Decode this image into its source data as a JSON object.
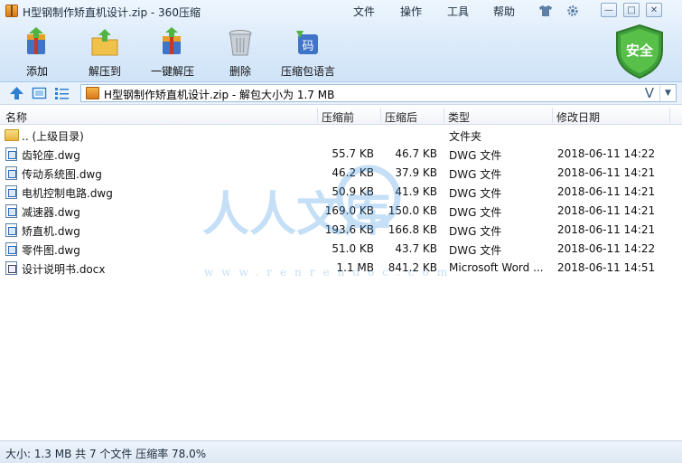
{
  "window": {
    "title": "H型钢制作矫直机设计.zip - 360压缩",
    "menu": [
      "文件",
      "操作",
      "工具",
      "帮助"
    ]
  },
  "toolbar": {
    "add": "添加",
    "extract_to": "解压到",
    "one_click_extract": "一键解压",
    "delete": "删除",
    "encoding": "压缩包语言",
    "encoding_icon_text": "码"
  },
  "security": {
    "label": "安全"
  },
  "address": {
    "path": "H型钢制作矫直机设计.zip - 解包大小为 1.7 MB",
    "v_glyph": "V"
  },
  "columns": {
    "name": "名称",
    "compressed_size": "压缩前",
    "packed_size": "压缩后",
    "type": "类型",
    "modified": "修改日期"
  },
  "parent_dir": {
    "name": ".. (上级目录)",
    "type": "文件夹"
  },
  "files": [
    {
      "name": "齿轮座.dwg",
      "original": "55.7 KB",
      "packed": "46.7 KB",
      "type": "DWG 文件",
      "date": "2018-06-11 14:22",
      "kind": "dwg"
    },
    {
      "name": "传动系统图.dwg",
      "original": "46.2 KB",
      "packed": "37.9 KB",
      "type": "DWG 文件",
      "date": "2018-06-11 14:21",
      "kind": "dwg"
    },
    {
      "name": "电机控制电路.dwg",
      "original": "50.9 KB",
      "packed": "41.9 KB",
      "type": "DWG 文件",
      "date": "2018-06-11 14:21",
      "kind": "dwg"
    },
    {
      "name": "减速器.dwg",
      "original": "169.0 KB",
      "packed": "150.0 KB",
      "type": "DWG 文件",
      "date": "2018-06-11 14:21",
      "kind": "dwg"
    },
    {
      "name": "矫直机.dwg",
      "original": "193.6 KB",
      "packed": "166.8 KB",
      "type": "DWG 文件",
      "date": "2018-06-11 14:21",
      "kind": "dwg"
    },
    {
      "name": "零件图.dwg",
      "original": "51.0 KB",
      "packed": "43.7 KB",
      "type": "DWG 文件",
      "date": "2018-06-11 14:22",
      "kind": "dwg"
    },
    {
      "name": "设计说明书.docx",
      "original": "1.1 MB",
      "packed": "841.2 KB",
      "type": "Microsoft Word ...",
      "date": "2018-06-11 14:51",
      "kind": "doc"
    }
  ],
  "watermark": {
    "text": "人人文库",
    "url": "www.renrendoc.com"
  },
  "status": {
    "text": "大小: 1.3 MB 共 7 个文件 压缩率 78.0%"
  }
}
